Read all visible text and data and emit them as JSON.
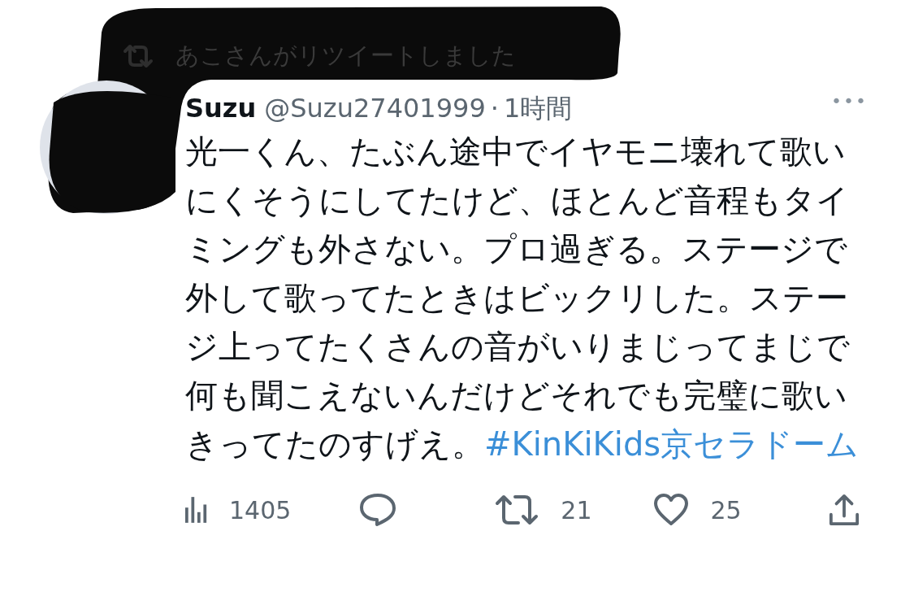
{
  "retweet_banner": {
    "text": "あこさんがリツイートしました"
  },
  "tweet": {
    "author_name": "Suzu",
    "handle": "@Suzu27401999",
    "separator": "·",
    "time": "1時間",
    "more": "•••",
    "body": "光一くん、たぶん途中でイヤモニ壊れて歌いにくそうにしてたけど、ほとんど音程もタイミングも外さない。プロ過ぎる。ステージで外して歌ってたときはビックリした。ステージ上ってたくさんの音がいりまじってまじで何も聞こえないんだけどそれでも完璧に歌いきってたのすげえ。",
    "hashtag": "#KinKiKids京セラドーム"
  },
  "actions": [
    {
      "kind": "views",
      "count": "1405"
    },
    {
      "kind": "reply"
    },
    {
      "kind": "retweet",
      "count": "21"
    },
    {
      "kind": "like",
      "count": "25"
    },
    {
      "kind": "share"
    }
  ]
}
